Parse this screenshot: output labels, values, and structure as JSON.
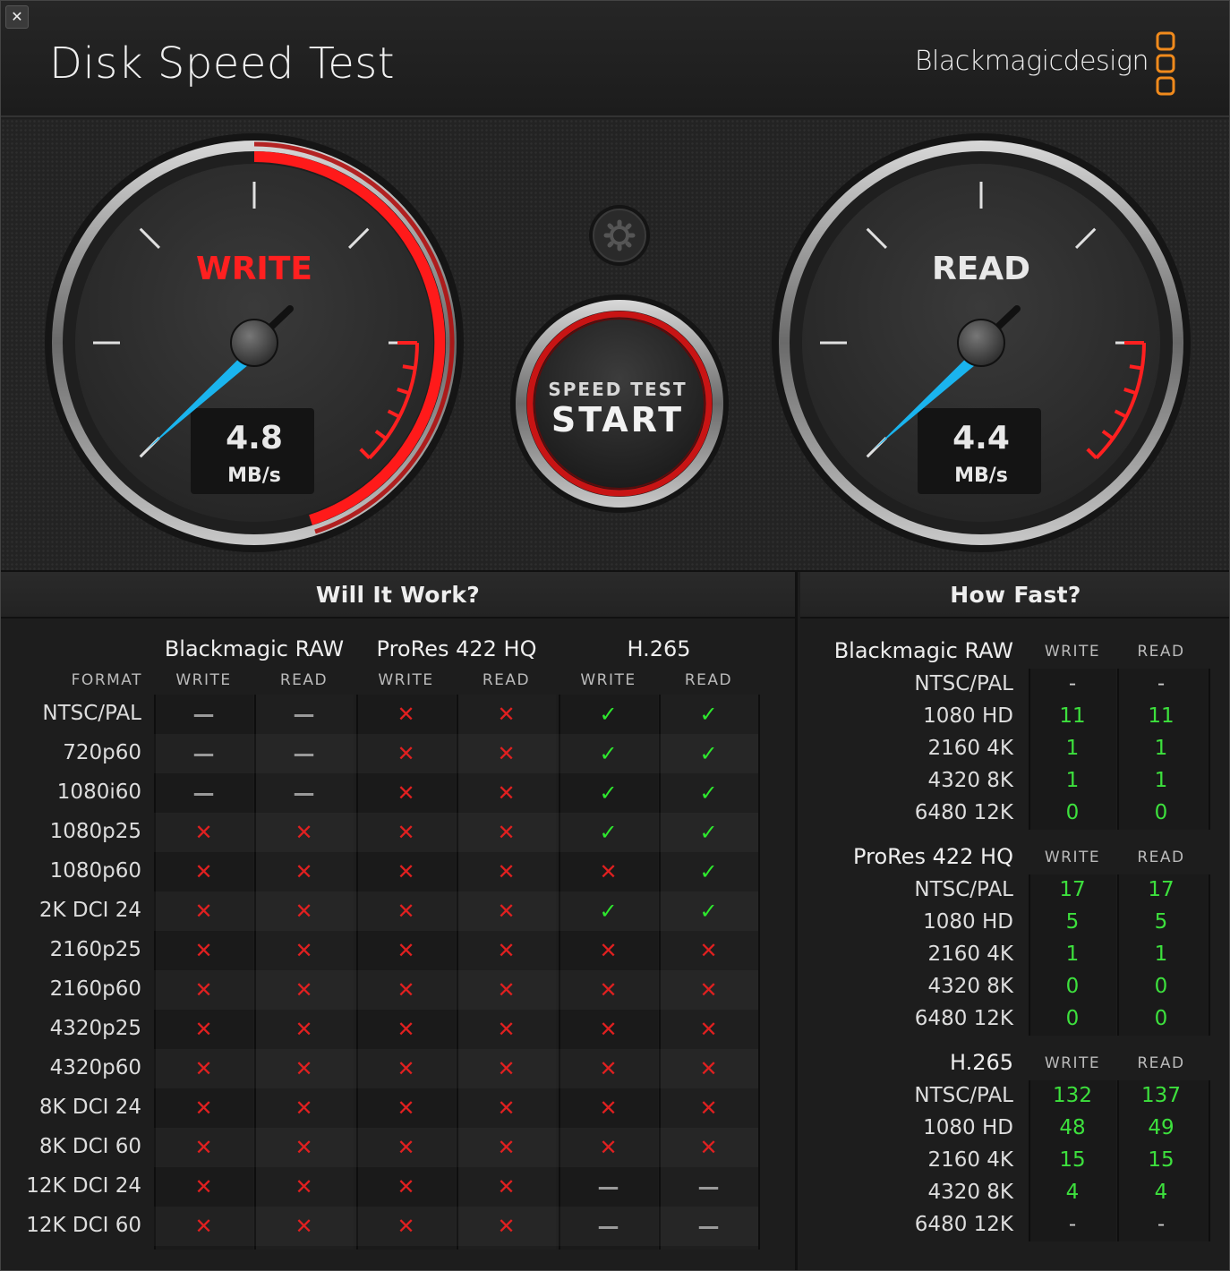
{
  "window": {
    "close_glyph": "✕",
    "title": "Disk Speed Test",
    "brand": "Blackmagicdesign",
    "brand_logo_icon": "three-square-logo-icon",
    "brand_color": "#f08a1c"
  },
  "gauges": {
    "write": {
      "label": "WRITE",
      "value": "4.8",
      "unit": "MB/s",
      "label_color": "#ff2020",
      "active": true
    },
    "read": {
      "label": "READ",
      "value": "4.4",
      "unit": "MB/s",
      "label_color": "#e8e8e8",
      "active": false
    },
    "needle_color": "#1ab4ee"
  },
  "start_button": {
    "top": "SPEED TEST",
    "main": "START",
    "ring_color": "#e01818"
  },
  "settings_button": {
    "icon": "gear-icon"
  },
  "will_it_work": {
    "title": "Will It Work?",
    "format_header": "FORMAT",
    "codecs": [
      {
        "name": "Blackmagic RAW",
        "write": "WRITE",
        "read": "READ"
      },
      {
        "name": "ProRes 422 HQ",
        "write": "WRITE",
        "read": "READ"
      },
      {
        "name": "H.265",
        "write": "WRITE",
        "read": "READ"
      }
    ],
    "rows": [
      {
        "format": "NTSC/PAL",
        "cells": [
          "na",
          "na",
          "x",
          "x",
          "ok",
          "ok"
        ]
      },
      {
        "format": "720p60",
        "cells": [
          "na",
          "na",
          "x",
          "x",
          "ok",
          "ok"
        ]
      },
      {
        "format": "1080i60",
        "cells": [
          "na",
          "na",
          "x",
          "x",
          "ok",
          "ok"
        ]
      },
      {
        "format": "1080p25",
        "cells": [
          "x",
          "x",
          "x",
          "x",
          "ok",
          "ok"
        ]
      },
      {
        "format": "1080p60",
        "cells": [
          "x",
          "x",
          "x",
          "x",
          "x",
          "ok"
        ]
      },
      {
        "format": "2K DCI 24",
        "cells": [
          "x",
          "x",
          "x",
          "x",
          "ok",
          "ok"
        ]
      },
      {
        "format": "2160p25",
        "cells": [
          "x",
          "x",
          "x",
          "x",
          "x",
          "x"
        ]
      },
      {
        "format": "2160p60",
        "cells": [
          "x",
          "x",
          "x",
          "x",
          "x",
          "x"
        ]
      },
      {
        "format": "4320p25",
        "cells": [
          "x",
          "x",
          "x",
          "x",
          "x",
          "x"
        ]
      },
      {
        "format": "4320p60",
        "cells": [
          "x",
          "x",
          "x",
          "x",
          "x",
          "x"
        ]
      },
      {
        "format": "8K DCI 24",
        "cells": [
          "x",
          "x",
          "x",
          "x",
          "x",
          "x"
        ]
      },
      {
        "format": "8K DCI 60",
        "cells": [
          "x",
          "x",
          "x",
          "x",
          "x",
          "x"
        ]
      },
      {
        "format": "12K DCI 24",
        "cells": [
          "x",
          "x",
          "x",
          "x",
          "na",
          "na"
        ]
      },
      {
        "format": "12K DCI 60",
        "cells": [
          "x",
          "x",
          "x",
          "x",
          "na",
          "na"
        ]
      }
    ],
    "glyphs": {
      "x": "✕",
      "ok": "✓",
      "na": "—"
    }
  },
  "how_fast": {
    "title": "How Fast?",
    "groups": [
      {
        "codec": "Blackmagic RAW",
        "write": "WRITE",
        "read": "READ",
        "rows": [
          {
            "format": "NTSC/PAL",
            "write": "-",
            "read": "-"
          },
          {
            "format": "1080 HD",
            "write": "11",
            "read": "11"
          },
          {
            "format": "2160 4K",
            "write": "1",
            "read": "1"
          },
          {
            "format": "4320 8K",
            "write": "1",
            "read": "1"
          },
          {
            "format": "6480 12K",
            "write": "0",
            "read": "0"
          }
        ]
      },
      {
        "codec": "ProRes 422 HQ",
        "write": "WRITE",
        "read": "READ",
        "rows": [
          {
            "format": "NTSC/PAL",
            "write": "17",
            "read": "17"
          },
          {
            "format": "1080 HD",
            "write": "5",
            "read": "5"
          },
          {
            "format": "2160 4K",
            "write": "1",
            "read": "1"
          },
          {
            "format": "4320 8K",
            "write": "0",
            "read": "0"
          },
          {
            "format": "6480 12K",
            "write": "0",
            "read": "0"
          }
        ]
      },
      {
        "codec": "H.265",
        "write": "WRITE",
        "read": "READ",
        "rows": [
          {
            "format": "NTSC/PAL",
            "write": "132",
            "read": "137"
          },
          {
            "format": "1080 HD",
            "write": "48",
            "read": "49"
          },
          {
            "format": "2160 4K",
            "write": "15",
            "read": "15"
          },
          {
            "format": "4320 8K",
            "write": "4",
            "read": "4"
          },
          {
            "format": "6480 12K",
            "write": "-",
            "read": "-"
          }
        ]
      }
    ]
  }
}
